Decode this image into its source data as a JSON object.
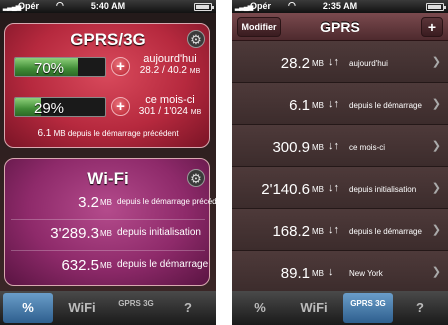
{
  "status": {
    "left": {
      "carrier": "Opér",
      "time": "5:40 AM"
    },
    "right": {
      "carrier": "Opér",
      "time": "2:35 AM"
    }
  },
  "gprs_card": {
    "title": "GPRS/3G",
    "today": {
      "percent": "70%",
      "percent_value": 0.7,
      "label": "aujourd'hui",
      "amount": "28.2 / 40.2",
      "unit": "MB"
    },
    "month": {
      "percent": "29%",
      "percent_value": 0.29,
      "label": "ce mois-ci",
      "amount": "301 / 1'024",
      "unit": "MB"
    },
    "footer": {
      "amount": "6.1",
      "unit": "MB",
      "text": "depuis le démarrage précédent"
    }
  },
  "wifi_card": {
    "title": "Wi-Fi",
    "rows": [
      {
        "value": "3.2",
        "unit": "MB",
        "desc": "depuis le démarrage précédent"
      },
      {
        "value": "3'289.3",
        "unit": "MB",
        "desc": "depuis initialisation"
      },
      {
        "value": "632.5",
        "unit": "MB",
        "desc": "depuis le démarrage"
      }
    ]
  },
  "tabs_left": [
    {
      "label": "%",
      "active": true
    },
    {
      "label": "WiFi",
      "active": false
    },
    {
      "label": "GPRS 3G",
      "active": false
    },
    {
      "label": "?",
      "active": false
    }
  ],
  "tabs_right": [
    {
      "label": "%",
      "active": false
    },
    {
      "label": "WiFi",
      "active": false
    },
    {
      "label": "GPRS 3G",
      "active": true
    },
    {
      "label": "?",
      "active": false
    }
  ],
  "gprs_list": {
    "title": "GPRS",
    "edit_label": "Modifier",
    "add_label": "+",
    "rows": [
      {
        "value": "28.2",
        "unit": "MB",
        "arrows": "↓↑",
        "desc": "aujourd'hui"
      },
      {
        "value": "6.1",
        "unit": "MB",
        "arrows": "↓↑",
        "desc": "depuis le démarrage"
      },
      {
        "value": "300.9",
        "unit": "MB",
        "arrows": "↓↑",
        "desc": "ce mois-ci"
      },
      {
        "value": "2'140.6",
        "unit": "MB",
        "arrows": "↓↑",
        "desc": "depuis initialisation"
      },
      {
        "value": "168.2",
        "unit": "MB",
        "arrows": "↓↑",
        "desc": "depuis le démarrage"
      },
      {
        "value": "89.1",
        "unit": "MB",
        "arrows": "↓",
        "desc": "New York"
      }
    ]
  },
  "colors": {
    "gprs_card": "#b6293e",
    "wifi_card": "#8e2a6a",
    "meter_fill": "#3f8c36",
    "tab_active": "#2e5f8e"
  }
}
